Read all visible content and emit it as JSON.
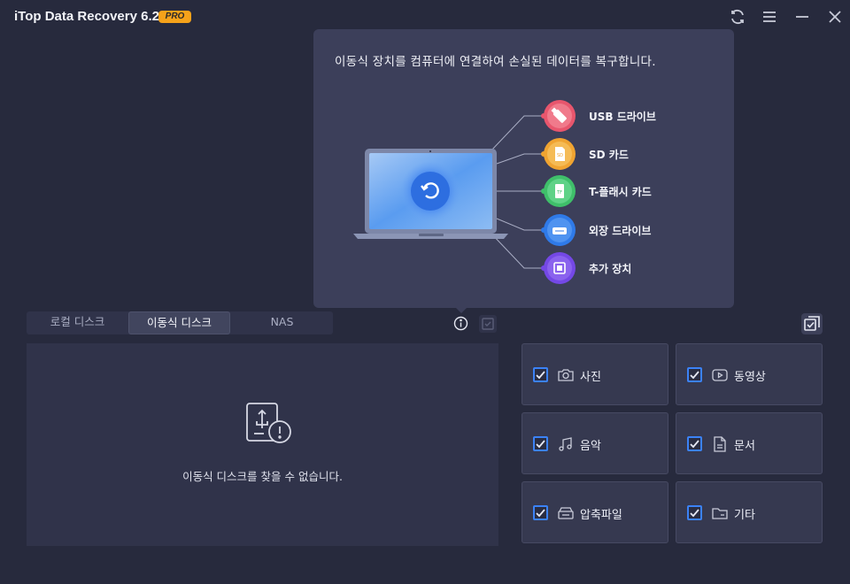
{
  "app": {
    "title": "iTop Data Recovery 6.2",
    "badge": "PRO"
  },
  "window_controls": [
    "refresh-icon",
    "menu-icon",
    "minimize-icon",
    "close-icon"
  ],
  "tooltip": {
    "text": "이동식 장치를 컴퓨터에 연결하여 손실된 데이터를 복구합니다.",
    "devices": [
      {
        "label": "USB 드라이브",
        "icon": "usb-drive-icon",
        "color": "#e8566d"
      },
      {
        "label": "SD 카드",
        "icon": "sd-card-icon",
        "color": "#f0a431"
      },
      {
        "label": "T-플래시 카드",
        "icon": "tflash-card-icon",
        "color": "#3fbf6a"
      },
      {
        "label": "외장 드라이브",
        "icon": "external-drive-icon",
        "color": "#2f7ae8"
      },
      {
        "label": "추가 장치",
        "icon": "chip-icon",
        "color": "#7448e6"
      }
    ]
  },
  "tabs": [
    {
      "label": "로컬 디스크",
      "active": false
    },
    {
      "label": "이동식 디스크",
      "active": true
    },
    {
      "label": "NAS",
      "active": false
    }
  ],
  "disk_panel": {
    "empty_text": "이동식 디스크를 찾을 수 없습니다."
  },
  "categories": [
    {
      "label": "사진",
      "icon": "camera-icon",
      "checked": true
    },
    {
      "label": "동영상",
      "icon": "video-icon",
      "checked": true
    },
    {
      "label": "음악",
      "icon": "music-icon",
      "checked": true
    },
    {
      "label": "문서",
      "icon": "document-icon",
      "checked": true
    },
    {
      "label": "압축파일",
      "icon": "archive-icon",
      "checked": true
    },
    {
      "label": "기타",
      "icon": "folder-icon",
      "checked": true
    }
  ],
  "colors": {
    "background": "#272a3d",
    "panel": "#30334a",
    "accent": "#3b82f6",
    "badge": "#f5a21a"
  }
}
